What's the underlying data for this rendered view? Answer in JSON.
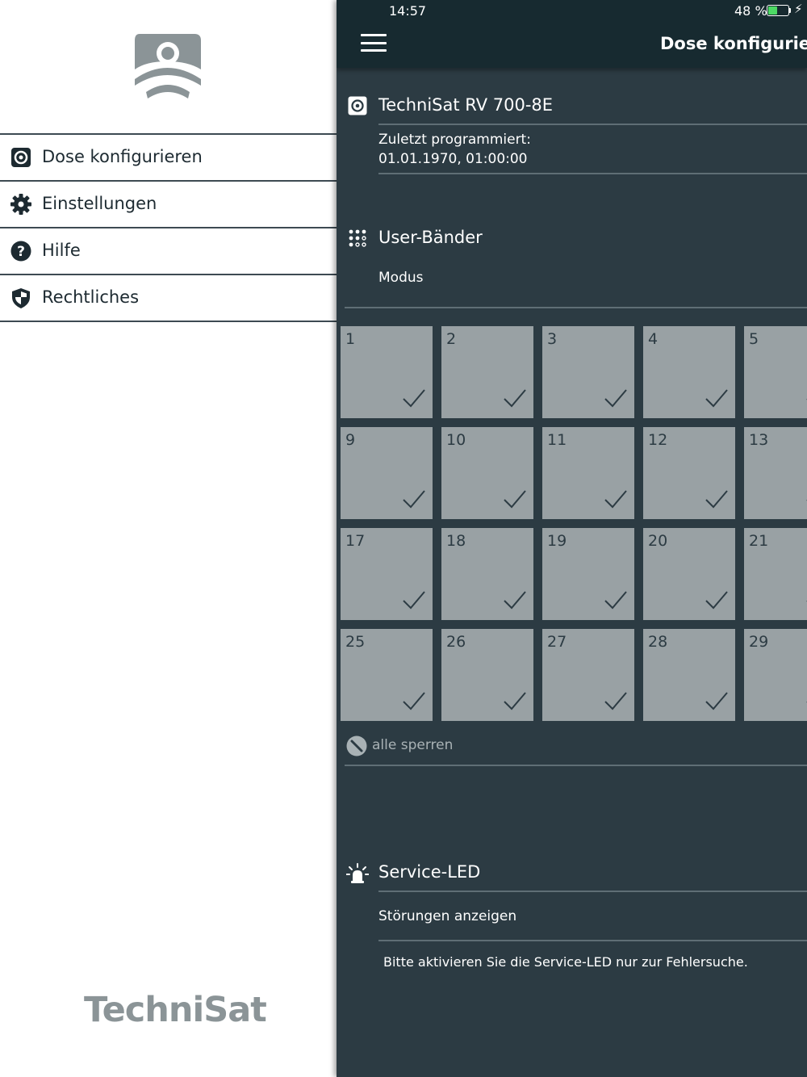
{
  "status_bar": {
    "time": "14:57",
    "battery": "48 %",
    "battery_level": 0.48
  },
  "drawer": {
    "menu": [
      {
        "label": "Dose konfigurieren",
        "icon": "socket-icon"
      },
      {
        "label": "Einstellungen",
        "icon": "gear-icon"
      },
      {
        "label": "Hilfe",
        "icon": "help-icon"
      },
      {
        "label": "Rechtliches",
        "icon": "shield-icon"
      }
    ],
    "brand": "TechniSat"
  },
  "nav": {
    "title": "Dose konfigurieren"
  },
  "device": {
    "name": "TechniSat RV 700-8E",
    "last_programmed_label": "Zuletzt programmiert:",
    "last_programmed_value": "01.01.1970, 01:00:00"
  },
  "user_bands": {
    "title": "User-Bänder",
    "mode_label": "Modus",
    "bands": [
      "1",
      "2",
      "3",
      "4",
      "5",
      "9",
      "10",
      "11",
      "12",
      "13",
      "17",
      "18",
      "19",
      "20",
      "21",
      "25",
      "26",
      "27",
      "28",
      "29"
    ],
    "lock_all_label": "alle sperren"
  },
  "service_led": {
    "title": "Service-LED",
    "toggle_label": "Störungen anzeigen",
    "info": "Bitte aktivieren Sie die Service-LED nur zur Fehlersuche."
  },
  "colors": {
    "panel": "#2c3b43",
    "topbar": "#172a30",
    "cell": "#99a1a4",
    "battery": "#4cd964"
  }
}
